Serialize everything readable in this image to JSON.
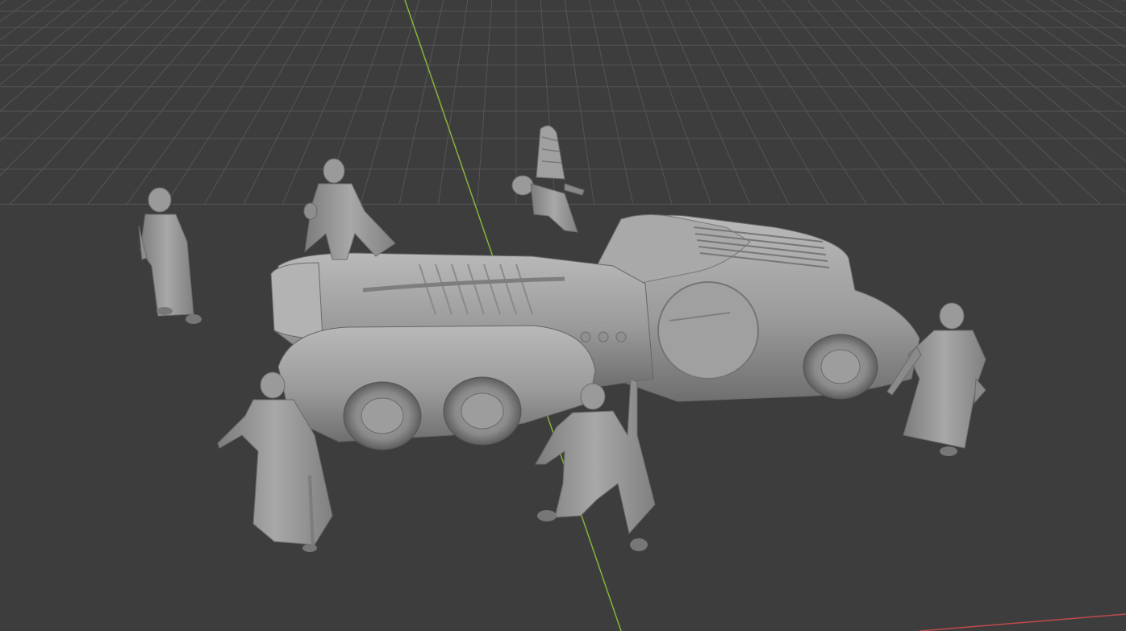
{
  "viewport": {
    "mode": "3d-viewport",
    "background_color": "#3d3d3d",
    "grid_color": "#555555",
    "grid_on": true,
    "x_axis_color": "#c04a4a",
    "y_axis_color": "#89b33a",
    "model_color": "#9a9a9a",
    "model_shade_color": "#7a7a7a",
    "model_highlight_color": "#bdbdbd"
  },
  "scene": {
    "objects": [
      {
        "name": "armored-car",
        "kind": "vehicle"
      },
      {
        "name": "robed-figure-left",
        "kind": "miniature"
      },
      {
        "name": "coated-figure-back",
        "kind": "miniature"
      },
      {
        "name": "winged-cherub",
        "kind": "miniature"
      },
      {
        "name": "robed-figure-front-left",
        "kind": "miniature"
      },
      {
        "name": "coated-figure-front",
        "kind": "miniature"
      },
      {
        "name": "robed-figure-right",
        "kind": "miniature"
      }
    ]
  }
}
